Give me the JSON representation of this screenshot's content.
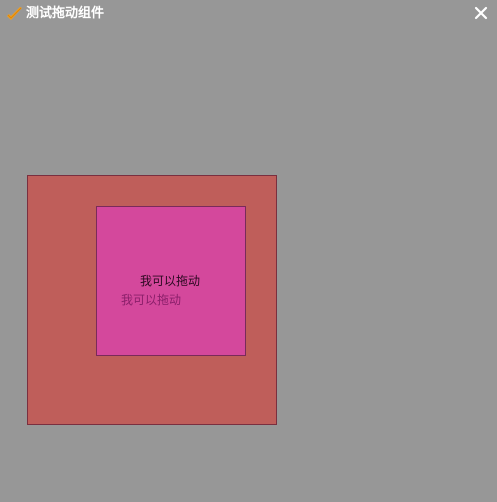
{
  "window": {
    "title": "测试拖动组件",
    "app_icon": "check-mark-icon",
    "close_icon": "close-icon"
  },
  "colors": {
    "background": "#979797",
    "title_text": "#ffffff",
    "icon_orange": "#f5a21b",
    "outer_box": "#bf5e5a",
    "outer_border": "#7a2f3f",
    "inner_box": "#d4489c",
    "inner_border": "#7a2a5a"
  },
  "draggable": {
    "label": "我可以拖动",
    "ghost_label": "我可以拖动"
  }
}
